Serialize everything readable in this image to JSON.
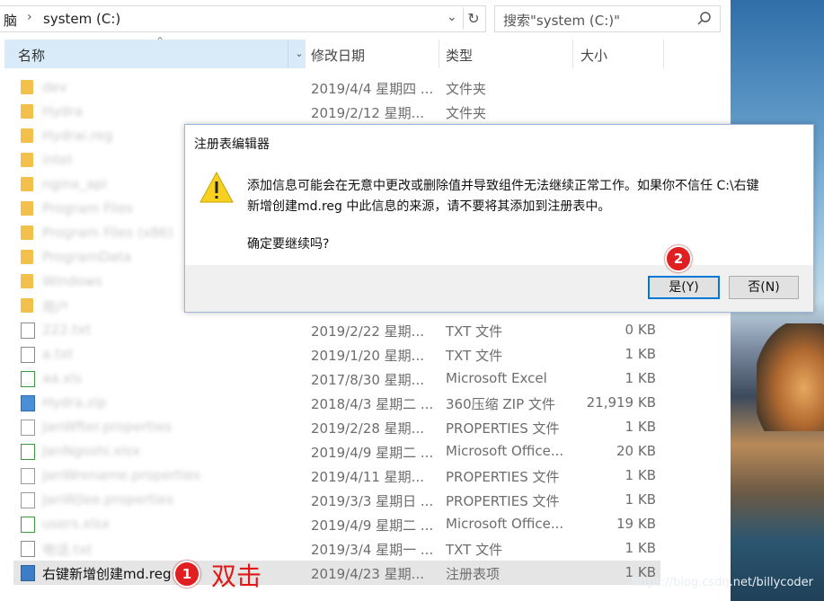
{
  "address": {
    "prefix": "脑",
    "path": "system (C:)"
  },
  "search": {
    "placeholder": "搜索\"system (C:)\""
  },
  "columns": {
    "name": "名称",
    "date": "修改日期",
    "type": "类型",
    "size": "大小"
  },
  "files": [
    {
      "name": "dev",
      "date": "2019/4/4 星期四 ...",
      "type": "文件夹",
      "size": "",
      "icon": "folder"
    },
    {
      "name": "Hydra",
      "date": "2019/2/12 星期...",
      "type": "文件夹",
      "size": "",
      "icon": "folder"
    },
    {
      "name": "Hydrai.reg",
      "date": "",
      "type": "",
      "size": "",
      "icon": "folder"
    },
    {
      "name": "inteI",
      "date": "",
      "type": "",
      "size": "",
      "icon": "folder"
    },
    {
      "name": "nginx_api",
      "date": "",
      "type": "",
      "size": "",
      "icon": "folder"
    },
    {
      "name": "Program Files",
      "date": "",
      "type": "",
      "size": "",
      "icon": "folder"
    },
    {
      "name": "Program Files (x86)",
      "date": "",
      "type": "",
      "size": "",
      "icon": "folder"
    },
    {
      "name": "ProgramData",
      "date": "",
      "type": "",
      "size": "",
      "icon": "folder"
    },
    {
      "name": "Windows",
      "date": "",
      "type": "",
      "size": "",
      "icon": "folder"
    },
    {
      "name": "用户",
      "date": "",
      "type": "",
      "size": "",
      "icon": "folder"
    },
    {
      "name": "222.txt",
      "date": "2019/2/22 星期...",
      "type": "TXT 文件",
      "size": "0 KB",
      "icon": "txt"
    },
    {
      "name": "a.txt",
      "date": "2019/1/20 星期...",
      "type": "TXT 文件",
      "size": "1 KB",
      "icon": "txt"
    },
    {
      "name": "aa.xls",
      "date": "2017/8/30 星期...",
      "type": "Microsoft Excel",
      "size": "1 KB",
      "icon": "xls"
    },
    {
      "name": "Hydra.zip",
      "date": "2018/4/3 星期二 ...",
      "type": "360压缩 ZIP 文件",
      "size": "21,919 KB",
      "icon": "zip"
    },
    {
      "name": "JanWfter.properties",
      "date": "2019/2/28 星期...",
      "type": "PROPERTIES 文件",
      "size": "1 KB",
      "icon": "prop"
    },
    {
      "name": "JanNgoshi.xlsx",
      "date": "2019/4/9 星期二 ...",
      "type": "Microsoft Office...",
      "size": "20 KB",
      "icon": "xls"
    },
    {
      "name": "JanWrename.properties",
      "date": "2019/4/11 星期...",
      "type": "PROPERTIES 文件",
      "size": "1 KB",
      "icon": "prop"
    },
    {
      "name": "JanWjlee.properties",
      "date": "2019/3/3 星期日 ...",
      "type": "PROPERTIES 文件",
      "size": "1 KB",
      "icon": "prop"
    },
    {
      "name": "users.xlsx",
      "date": "2019/4/9 星期二 ...",
      "type": "Microsoft Office...",
      "size": "19 KB",
      "icon": "xls"
    },
    {
      "name": "电话.txt",
      "date": "2019/3/4 星期一 ...",
      "type": "TXT 文件",
      "size": "1 KB",
      "icon": "txt"
    },
    {
      "name": "右键新增创建md.reg",
      "date": "2019/4/23 星期...",
      "type": "注册表项",
      "size": "1 KB",
      "icon": "reg"
    }
  ],
  "dialog": {
    "title": "注册表编辑器",
    "message_line1": "添加信息可能会在无意中更改或删除值并导致组件无法继续正常工作。如果你不信任 C:\\右键",
    "message_line2": "新增创建md.reg 中此信息的来源，请不要将其添加到注册表中。",
    "confirm": "确定要继续吗?",
    "yes_label": "是(Y)",
    "no_label": "否(N)"
  },
  "annotations": {
    "step1": "1",
    "step2": "2",
    "double_click": "双击"
  },
  "watermark": "https://blog.csdn.net/billycoder"
}
